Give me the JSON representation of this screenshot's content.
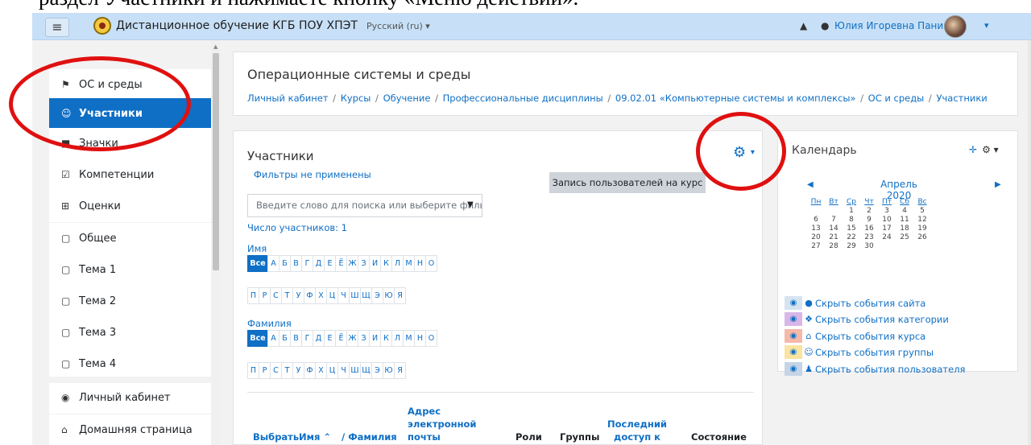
{
  "document_line": "раздел Участники и нажимаете кнопку «Меню действий».",
  "navbar": {
    "menu_label": "≡",
    "site_title": "Дистанционное обучение КГБ ПОУ ХПЭТ",
    "language": "Русский (ru) ▾",
    "user_name": "Юлия Игоревна Панина",
    "icons": [
      "bell-icon",
      "chat-icon",
      "caret-down-icon"
    ]
  },
  "drawer": {
    "items": [
      {
        "label": "ОС и среды",
        "icon": "graduation-cap-icon",
        "active": false
      },
      {
        "label": "Участники",
        "icon": "users-icon",
        "active": true
      },
      {
        "label": "Значки",
        "icon": "badge-icon",
        "active": false
      },
      {
        "label": "Компетенции",
        "icon": "checkbox-icon",
        "active": false
      },
      {
        "label": "Оценки",
        "icon": "table-icon",
        "active": false
      },
      {
        "label": "Общее",
        "icon": "folder-icon",
        "active": false
      },
      {
        "label": "Тема 1",
        "icon": "folder-icon",
        "active": false
      },
      {
        "label": "Тема 2",
        "icon": "folder-icon",
        "active": false
      },
      {
        "label": "Тема 3",
        "icon": "folder-icon",
        "active": false
      },
      {
        "label": "Тема 4",
        "icon": "folder-icon",
        "active": false
      },
      {
        "label": "Личный кабинет",
        "icon": "dashboard-icon",
        "active": false
      },
      {
        "label": "Домашняя страница",
        "icon": "home-icon",
        "active": false
      }
    ]
  },
  "header": {
    "title": "Операционные системы и среды",
    "breadcrumb": [
      "Личный кабинет",
      "Курсы",
      "Обучение",
      "Профессиональные дисциплины",
      "09.02.01 «Компьютерные системы и комплексы»",
      "ОС и среды",
      "Участники"
    ]
  },
  "participants": {
    "title": "Участники",
    "filters_text": "Фильтры не применены",
    "enrol_button": "Запись пользователей на курс",
    "search_placeholder": "Введите слово для поиска или выберите фильтр",
    "count_text": "Число участников: 1",
    "firstname_label": "Имя",
    "lastname_label": "Фамилия",
    "all_label": "Все",
    "letters_row1": [
      "А",
      "Б",
      "В",
      "Г",
      "Д",
      "Е",
      "Ё",
      "Ж",
      "З",
      "И",
      "К",
      "Л",
      "М",
      "Н",
      "О"
    ],
    "letters_row2": [
      "П",
      "Р",
      "С",
      "Т",
      "У",
      "Ф",
      "Х",
      "Ц",
      "Ч",
      "Ш",
      "Щ",
      "Э",
      "Ю",
      "Я"
    ],
    "columns": {
      "select": "Выбрать",
      "name": "Имя ⌃",
      "surname": "/ Фамилия",
      "email": "Адрес электронной почты",
      "roles": "Роли",
      "groups": "Группы",
      "lastaccess": "Последний доступ к курсу",
      "status": "Состояние"
    }
  },
  "calendar": {
    "title": "Календарь",
    "month": "Апрель 2020",
    "weekdays": [
      "Пн",
      "Вт",
      "Ср",
      "Чт",
      "Пт",
      "Сб",
      "Вс"
    ],
    "weeks": [
      [
        "",
        "",
        "1",
        "2",
        "3",
        "4",
        "5"
      ],
      [
        "6",
        "7",
        "8",
        "9",
        "10",
        "11",
        "12"
      ],
      [
        "13",
        "14",
        "15",
        "16",
        "17",
        "18",
        "19"
      ],
      [
        "20",
        "21",
        "22",
        "23",
        "24",
        "25",
        "26"
      ],
      [
        "27",
        "28",
        "29",
        "30",
        "",
        "",
        ""
      ]
    ],
    "legend": [
      {
        "label": "Скрыть события сайта",
        "color": "#d6e4f0",
        "icon": "globe-icon"
      },
      {
        "label": "Скрыть события категории",
        "color": "#d8b6e8",
        "icon": "cubes-icon"
      },
      {
        "label": "Скрыть события курса",
        "color": "#f6b8a8",
        "icon": "university-icon"
      },
      {
        "label": "Скрыть события группы",
        "color": "#fbe3a0",
        "icon": "group-icon"
      },
      {
        "label": "Скрыть события пользователя",
        "color": "#c5d4e6",
        "icon": "user-icon"
      }
    ]
  },
  "colors": {
    "accent": "#0f6fc5",
    "navbar": "#c7e0f7",
    "annotation": "#e01010"
  }
}
